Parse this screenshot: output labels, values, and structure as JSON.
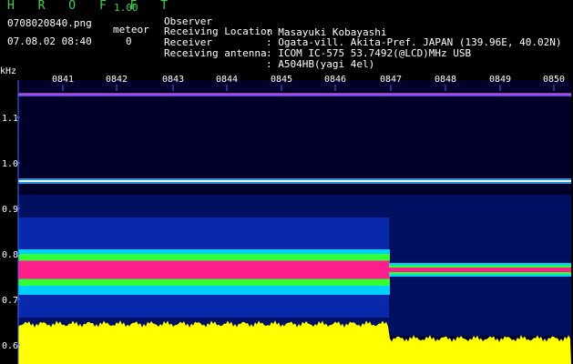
{
  "header": {
    "app_title": "H R O F F T",
    "app_version": "1.00",
    "file_name": "0708020840.png",
    "datetime": "07.08.02 08:40",
    "meteor_label": "meteor",
    "meteor_count": "0"
  },
  "info": [
    {
      "key": "Observer",
      "value": ": Masayuki Kobayashi"
    },
    {
      "key": "Receiving Location",
      "value": ": Ogata-vill. Akita-Pref. JAPAN (139.96E, 40.02N)"
    },
    {
      "key": "Receiver",
      "value": ": ICOM IC-575 53.7492(@LCD)MHz USB"
    },
    {
      "key": "Receiving antenna",
      "value": ": A504HB(yagi 4el)"
    }
  ],
  "y_unit": "kHz",
  "x_ticks": [
    "0841",
    "0842",
    "0843",
    "0844",
    "0845",
    "0846",
    "0847",
    "0848",
    "0849",
    "0850"
  ],
  "y_ticks": [
    "1.1",
    "1.0",
    "0.9",
    "0.8",
    "0.7",
    "0.6"
  ],
  "colors": {
    "background": "#000000",
    "title_green": "#3fd24f",
    "tick_blue": "#3a6cff",
    "baseline_yellow": "#ffff00",
    "signal_magenta": "#ff1e8c",
    "signal_green": "#33ff33",
    "noise_blue": "#1a3cff"
  }
}
